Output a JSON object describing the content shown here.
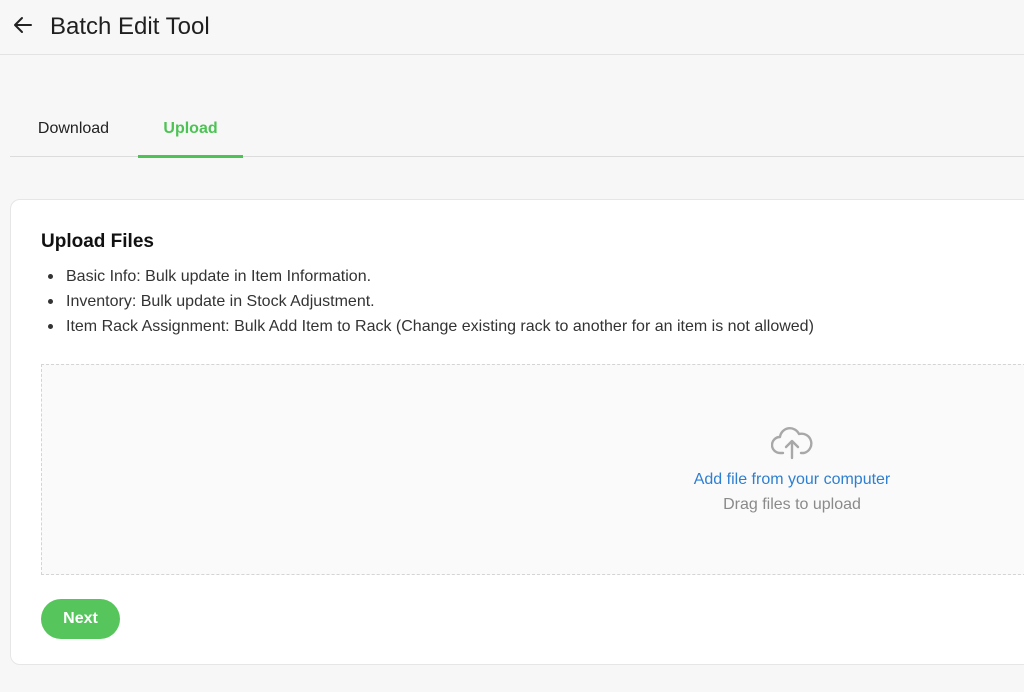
{
  "header": {
    "back_icon": "arrow-left-icon",
    "title": "Batch Edit Tool"
  },
  "tabs": [
    {
      "label": "Download",
      "active": false
    },
    {
      "label": "Upload",
      "active": true
    }
  ],
  "colors": {
    "accent": "#4cc354",
    "link": "#2e7fd1",
    "button": "#56c65c"
  },
  "upload_card": {
    "title": "Upload Files",
    "items": [
      "Basic Info: Bulk update in Item Information.",
      "Inventory: Bulk update in Stock Adjustment.",
      "Item Rack Assignment: Bulk Add Item to Rack (Change existing rack to another for an item is not allowed)"
    ],
    "dropzone": {
      "icon": "cloud-upload-icon",
      "link_text": "Add file from your computer",
      "hint": "Drag files to upload"
    },
    "next_label": "Next"
  }
}
